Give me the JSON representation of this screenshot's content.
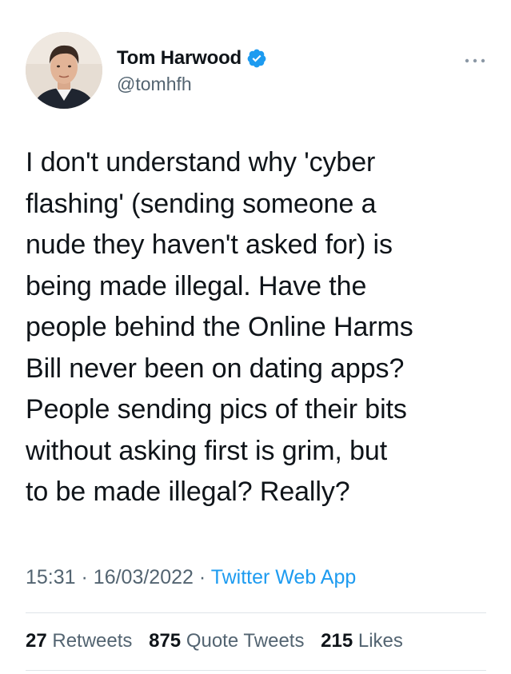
{
  "author": {
    "display_name": "Tom Harwood",
    "handle": "@tomhfh",
    "verified": true,
    "avatar_icon": "profile-photo"
  },
  "tweet": {
    "text_lines": [
      "I don't understand why 'cyber",
      "flashing' (sending someone a",
      "nude they haven't asked for) is",
      "being made illegal. Have the",
      "people behind the Online Harms",
      "Bill never been on dating apps?",
      "People sending pics of their bits",
      "without asking first is grim, but",
      "to be made illegal? Really?"
    ],
    "time": "15:31",
    "date": "16/03/2022",
    "separator": "·",
    "source": "Twitter Web App"
  },
  "stats": {
    "retweets_count": "27",
    "retweets_label": "Retweets",
    "quotes_count": "875",
    "quotes_label": "Quote Tweets",
    "likes_count": "215",
    "likes_label": "Likes"
  },
  "colors": {
    "text": "#0f1419",
    "secondary": "#536471",
    "accent": "#1d9bf0",
    "divider": "#dfe4e8"
  }
}
